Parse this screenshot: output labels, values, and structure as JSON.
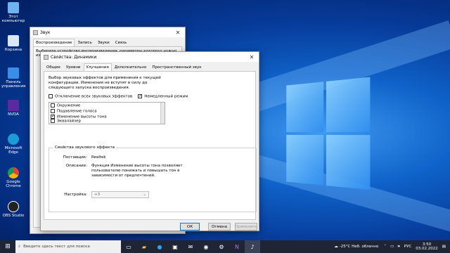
{
  "desktop": {
    "icons": [
      {
        "label": "Этот компьютер",
        "color": "#6cb3f0"
      },
      {
        "label": "Корзина",
        "color": "#d9e9f7"
      },
      {
        "label": "Панель управления",
        "color": "#3a8ee6"
      },
      {
        "label": "NVDA",
        "color": "#5b2aa0"
      },
      {
        "label": "Microsoft Edge",
        "color": "#1d9bd6"
      },
      {
        "label": "Google Chrome",
        "color": "#e8b83a"
      },
      {
        "label": "OBS Studio",
        "color": "#222222"
      }
    ]
  },
  "sound_window": {
    "title": "Звук",
    "tabs": [
      "Воспроизведение",
      "Запись",
      "Звуки",
      "Связь"
    ],
    "instruction": "Выберите устройство воспроизведения, параметры которого нужно изменить:"
  },
  "props_window": {
    "title": "Свойства: Динамики",
    "tabs": [
      "Общие",
      "Уровни",
      "Улучшения",
      "Дополнительно",
      "Пространственный звук"
    ],
    "active_tab": "Улучшения",
    "description": "Выбор звуковых эффектов для применения к текущей конфигурации. Изменения не вступят в силу до следующего запуска воспроизведения.",
    "disable_all_label": "Отключение всех звуковых эффектов",
    "immediate_mode_label": "Немедленный режим",
    "effects": [
      {
        "label": "Окружение",
        "checked": false
      },
      {
        "label": "Подавление голоса",
        "checked": false
      },
      {
        "label": "Изменение высоты тона",
        "checked": true
      },
      {
        "label": "Эквалайзер",
        "checked": false
      }
    ],
    "group_title": "Свойства звукового эффекта",
    "provider_label": "Поставщик:",
    "provider_value": "Realtek",
    "description_label": "Описание:",
    "description_value": "Функция Изменение высоты тона позволяет пользователю понижать и повышать тон в зависимости от предпочтений.",
    "setting_label": "Настройка:",
    "setting_value": "+3",
    "ok_label": "ОК",
    "cancel_label": "Отмена",
    "apply_label": "Применить"
  },
  "taskbar": {
    "search_placeholder": "Введите здесь текст для поиска",
    "weather": "-25°C Неб. облачно",
    "language": "РУС",
    "time": "3:50",
    "date": "03.02.2022"
  }
}
